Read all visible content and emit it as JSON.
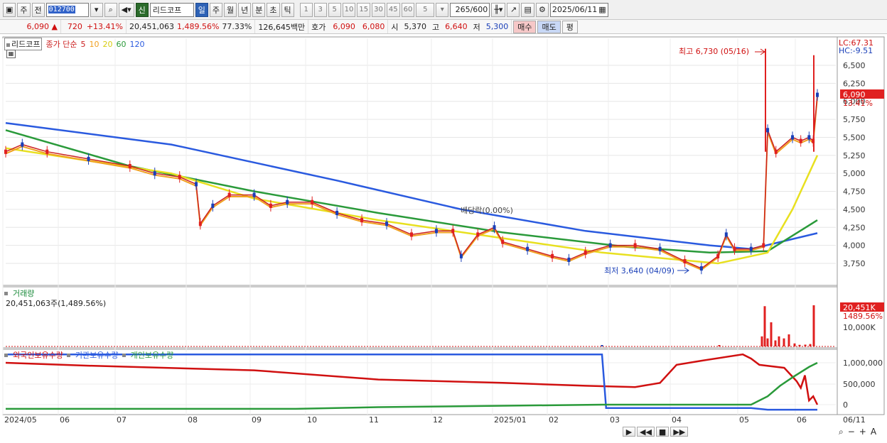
{
  "toolbar": {
    "period_week": "주",
    "prev_label": "전",
    "stock_code": "012700",
    "new_label": "신",
    "stock_name": "리드코프",
    "tabs": [
      "일",
      "주",
      "월",
      "년",
      "분",
      "초",
      "틱"
    ],
    "active_tab": "일",
    "numbers": [
      "1",
      "3",
      "5",
      "10",
      "15",
      "30",
      "45",
      "60"
    ],
    "interval_value": "5",
    "count_display": "265/600",
    "date_value": "2025/06/11"
  },
  "quote": {
    "price": "6,090",
    "change": "720",
    "change_pct": "+13.41%",
    "volume": "20,451,063",
    "volume_ratio": "1,489.56%",
    "turnover_ratio": "77.33%",
    "amount": "126,645백만",
    "quote_label": "호가",
    "ask": "6,090",
    "bid": "6,080",
    "open_label": "시",
    "open": "5,370",
    "high_label": "고",
    "high": "6,640",
    "low_label": "저",
    "low": "5,300",
    "buy_label": "매수",
    "sell_label": "매도",
    "eval_label": "평"
  },
  "price_panel": {
    "title": "리드코프",
    "ma_label": "종가 단순",
    "ma_periods": [
      {
        "label": "5",
        "color": "#cc2020"
      },
      {
        "label": "10",
        "color": "#f0a020"
      },
      {
        "label": "20",
        "color": "#e8e020"
      },
      {
        "label": "60",
        "color": "#2a9a3a"
      },
      {
        "label": "120",
        "color": "#2a5adf"
      }
    ],
    "lc": "LC:67.31",
    "hc": "HC:-9.51",
    "current_price_tag": "6,090",
    "current_pct_tag": "13.41%",
    "high_annot": "최고 6,730 (05/16)",
    "low_annot": "최저 3,640 (04/09)",
    "dividend_annot": "배당락(0.00%)",
    "y_ticks": [
      "6,500",
      "6,250",
      "6,000",
      "5,750",
      "5,500",
      "5,250",
      "5,000",
      "4,750",
      "4,500",
      "4,250",
      "4,000",
      "3,750"
    ]
  },
  "volume_panel": {
    "title": "거래량",
    "value": "20,451,063주(1,489.56%)",
    "tag_value": "20,451K",
    "tag_pct": "1489.56%",
    "y_tick": "10,000K"
  },
  "holding_panel": {
    "legend": [
      {
        "label": "외국인보유수량",
        "color": "#d01010"
      },
      {
        "label": "기관보유수량",
        "color": "#2a5adf"
      },
      {
        "label": "개인보유수량",
        "color": "#2a9a3a"
      }
    ],
    "y_ticks": [
      "1,000,000",
      "500,000",
      "0"
    ]
  },
  "x_axis": [
    "2024/05",
    "06",
    "07",
    "08",
    "09",
    "10",
    "11",
    "12",
    "2025/01",
    "02",
    "03",
    "04",
    "05",
    "06",
    "06/11"
  ],
  "colors": {
    "up": "#e02020",
    "down": "#1a3fb8",
    "ma5": "#cc2020",
    "ma10": "#f0a020",
    "ma20": "#e8e020",
    "ma60": "#2a9a3a",
    "ma120": "#2a5adf"
  }
}
